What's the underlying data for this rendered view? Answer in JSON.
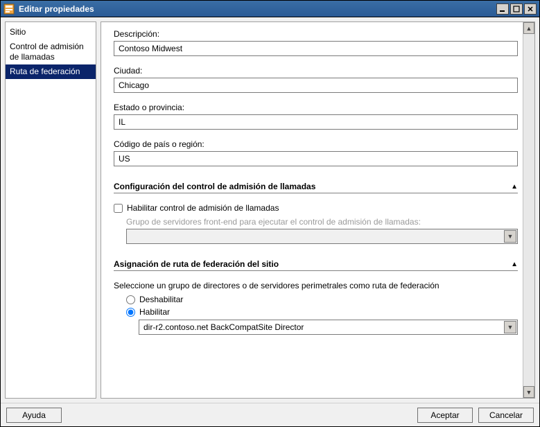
{
  "window": {
    "title": "Editar propiedades"
  },
  "sidebar": {
    "items": [
      {
        "label": "Sitio"
      },
      {
        "label": "Control de admisión de llamadas"
      },
      {
        "label": "Ruta de federación"
      }
    ],
    "selectedIndex": 2
  },
  "form": {
    "description": {
      "label": "Descripción:",
      "value": "Contoso Midwest"
    },
    "city": {
      "label": "Ciudad:",
      "value": "Chicago"
    },
    "state": {
      "label": "Estado o provincia:",
      "value": "IL"
    },
    "country": {
      "label": "Código de país o región:",
      "value": "US"
    }
  },
  "sections": {
    "cac": {
      "title": "Configuración del control de admisión de llamadas",
      "enable_label": "Habilitar control de admisión de llamadas",
      "pool_label": "Grupo de servidores front-end para ejecutar el control de admisión de llamadas:",
      "enabled": false,
      "pool_value": ""
    },
    "federation": {
      "title": "Asignación de ruta de federación del sitio",
      "instruction": "Seleccione un grupo de directores o de servidores perimetrales como ruta de federación",
      "disable_label": "Deshabilitar",
      "enable_label": "Habilitar",
      "selected": "enable",
      "route_value": "dir-r2.contoso.net   BackCompatSite   Director"
    }
  },
  "footer": {
    "help": "Ayuda",
    "ok": "Aceptar",
    "cancel": "Cancelar"
  }
}
